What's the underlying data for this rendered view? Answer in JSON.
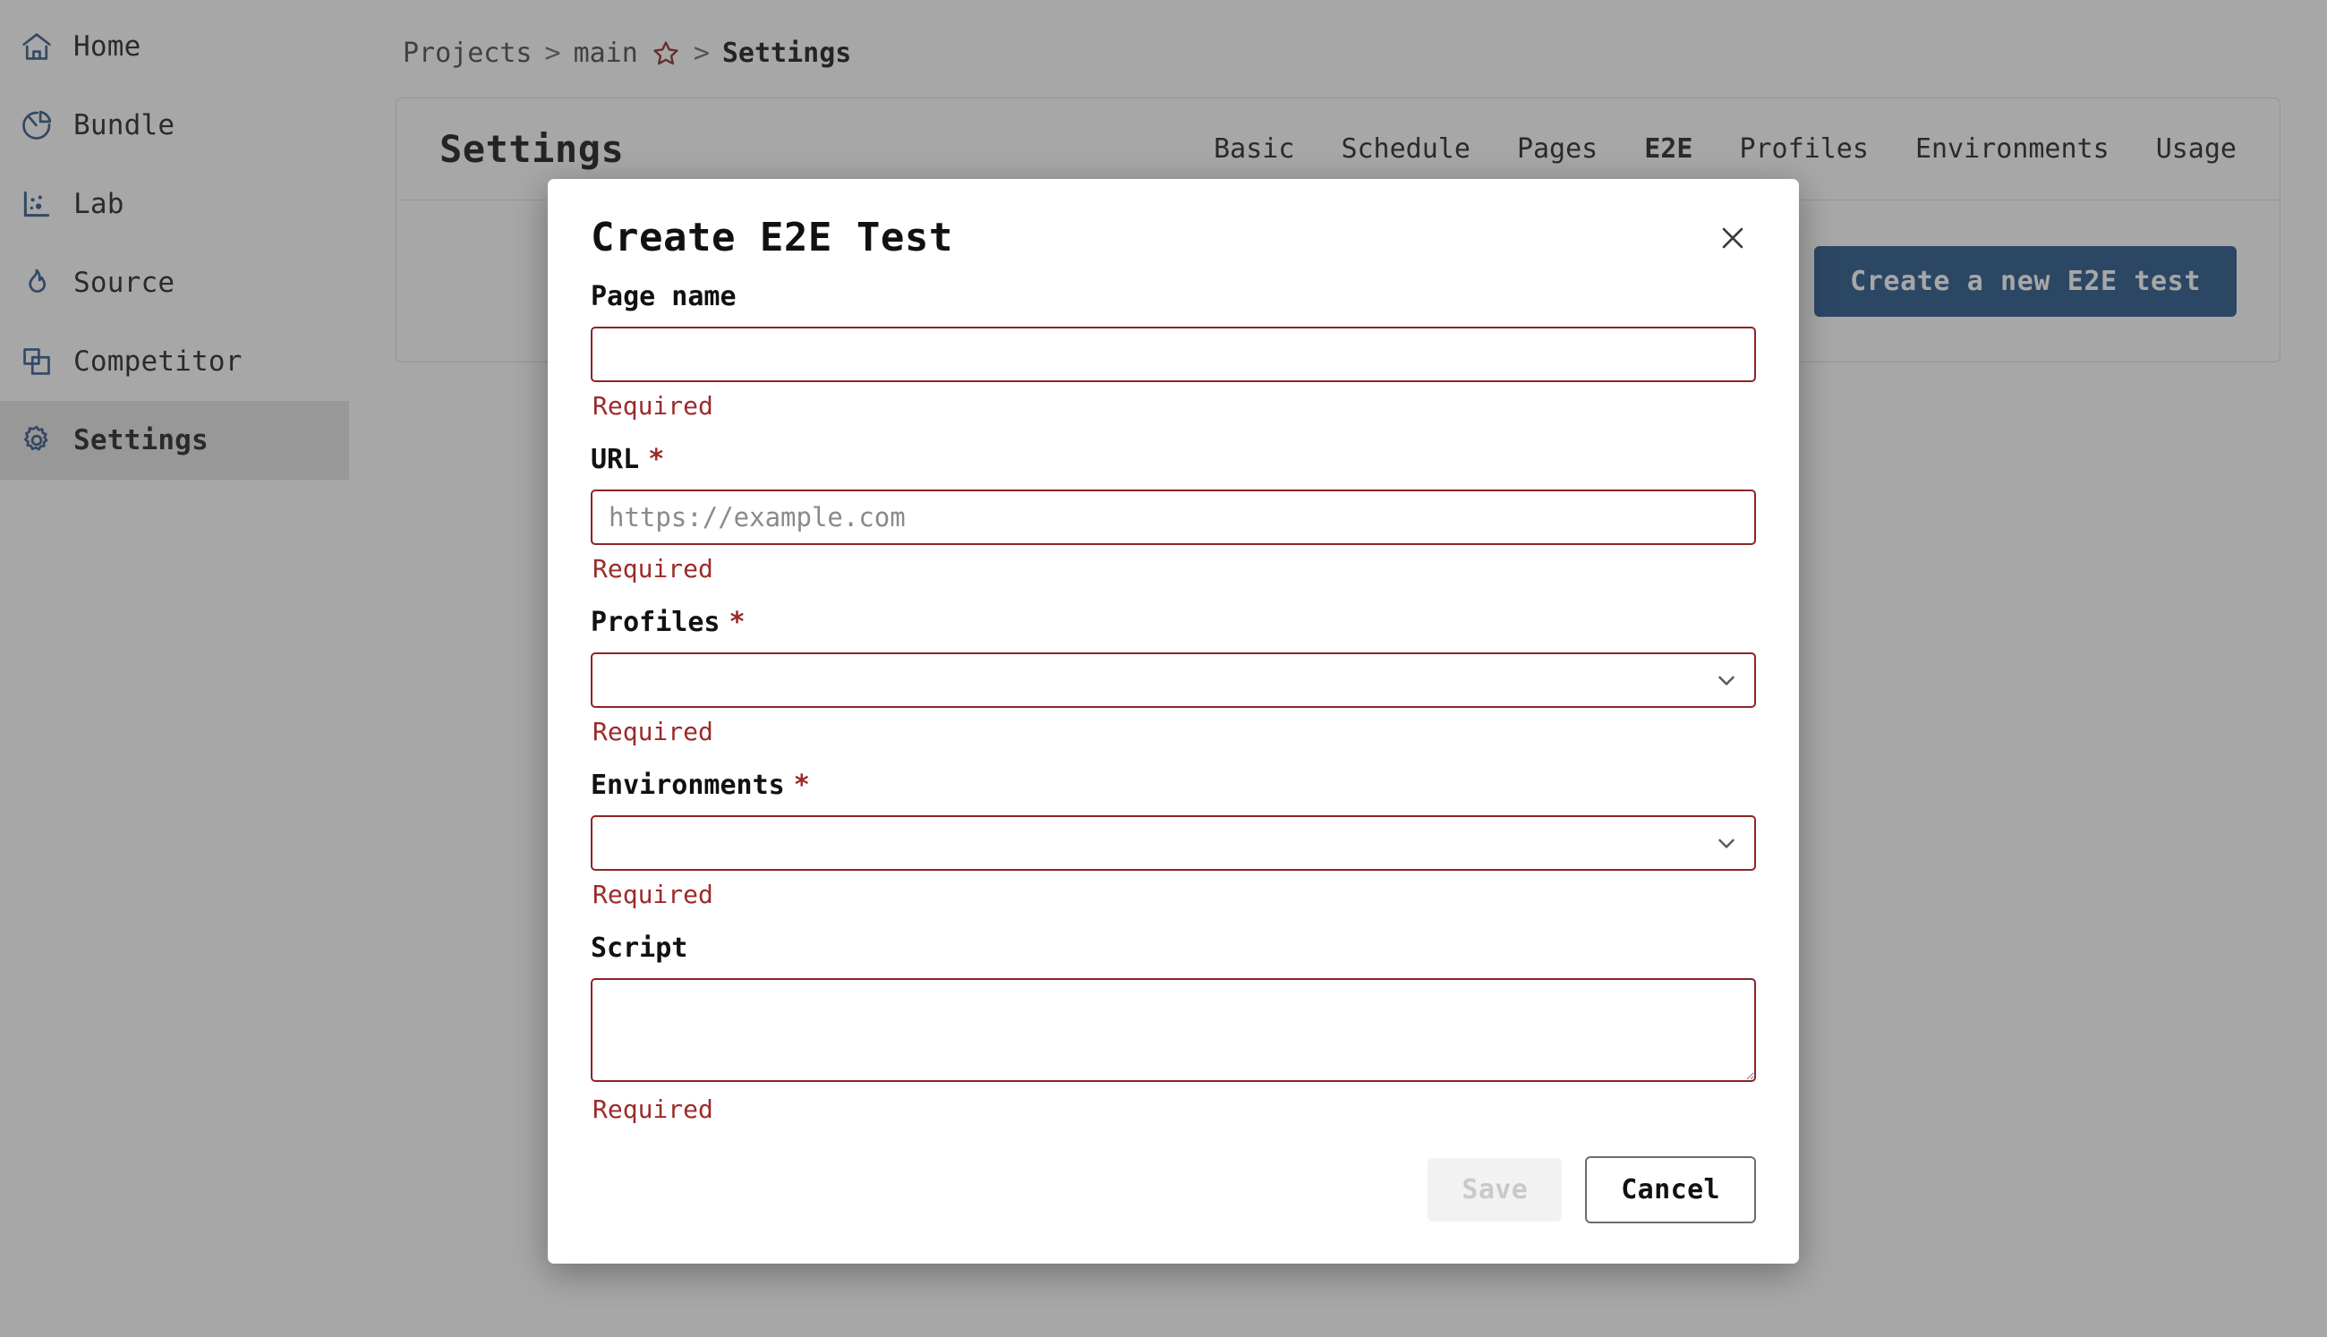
{
  "sidebar": {
    "items": [
      {
        "label": "Home",
        "icon": "home-icon",
        "active": false
      },
      {
        "label": "Bundle",
        "icon": "pie-chart-icon",
        "active": false
      },
      {
        "label": "Lab",
        "icon": "scatter-plot-icon",
        "active": false
      },
      {
        "label": "Source",
        "icon": "flame-icon",
        "active": false
      },
      {
        "label": "Competitor",
        "icon": "layers-icon",
        "active": false
      },
      {
        "label": "Settings",
        "icon": "gear-icon",
        "active": true
      }
    ]
  },
  "breadcrumb": {
    "projects": "Projects",
    "sep1": ">",
    "branch": "main",
    "star_icon": "star-outline-icon",
    "sep2": ">",
    "current": "Settings"
  },
  "card": {
    "title": "Settings",
    "tabs": [
      {
        "label": "Basic",
        "active": false
      },
      {
        "label": "Schedule",
        "active": false
      },
      {
        "label": "Pages",
        "active": false
      },
      {
        "label": "E2E",
        "active": true
      },
      {
        "label": "Profiles",
        "active": false
      },
      {
        "label": "Environments",
        "active": false
      },
      {
        "label": "Usage",
        "active": false
      }
    ],
    "create_button": "Create a new E2E test"
  },
  "modal": {
    "title": "Create E2E Test",
    "close_icon": "close-icon",
    "fields": {
      "page_name": {
        "label": "Page name",
        "required_mark": "",
        "value": "",
        "placeholder": "",
        "error": "Required"
      },
      "url": {
        "label": "URL",
        "required_mark": "*",
        "value": "",
        "placeholder": "https://example.com",
        "error": "Required"
      },
      "profiles": {
        "label": "Profiles",
        "required_mark": "*",
        "selected": "",
        "options": [
          ""
        ],
        "chevron_icon": "chevron-down-icon",
        "error": "Required"
      },
      "environments": {
        "label": "Environments",
        "required_mark": "*",
        "selected": "",
        "options": [
          ""
        ],
        "chevron_icon": "chevron-down-icon",
        "error": "Required"
      },
      "script": {
        "label": "Script",
        "required_mark": "",
        "value": "",
        "placeholder": "",
        "error": "Required"
      }
    },
    "save_label": "Save",
    "cancel_label": "Cancel"
  },
  "colors": {
    "accent_blue": "#1f5186",
    "error_red": "#8f2424",
    "icon_blue": "#2b5483",
    "star_red": "#8f2424"
  }
}
